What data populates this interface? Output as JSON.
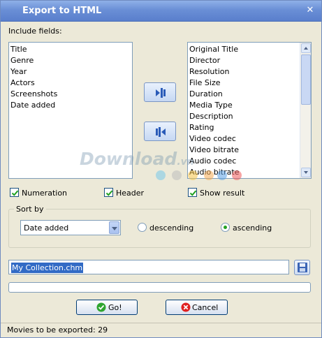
{
  "window": {
    "title": "Export to HTML"
  },
  "fields_label": "Include fields:",
  "included_fields": [
    "Title",
    "Genre",
    "Year",
    "Actors",
    "Screenshots",
    "Date added"
  ],
  "available_fields": [
    "Original Title",
    "Director",
    "Resolution",
    "File Size",
    "Duration",
    "Media Type",
    "Description",
    "Rating",
    "Video codec",
    "Video bitrate",
    "Audio codec",
    "Audio bitrate"
  ],
  "options": {
    "numeration": {
      "label": "Numeration",
      "checked": true
    },
    "header": {
      "label": "Header",
      "checked": true
    },
    "show_result": {
      "label": "Show result",
      "checked": true
    }
  },
  "sort": {
    "label": "Sort by",
    "selected": "Date added",
    "descending_label": "descending",
    "ascending_label": "ascending",
    "order": "ascending"
  },
  "filename": "My Collection.chm",
  "progress": 0,
  "buttons": {
    "go": "Go!",
    "cancel": "Cancel"
  },
  "status": "Movies to be exported: 29",
  "watermark": {
    "text": "Download",
    "suffix": ".vn"
  },
  "colors": {
    "title_bar": "#6a8fd6",
    "check": "#21a121",
    "selection": "#316ac5"
  },
  "icons": {
    "close": "close-icon",
    "add_field": "arrow-left-field-icon",
    "remove_field": "arrow-right-field-icon",
    "save": "save-disk-icon",
    "go": "check-circle-icon",
    "cancel": "cancel-x-icon"
  }
}
